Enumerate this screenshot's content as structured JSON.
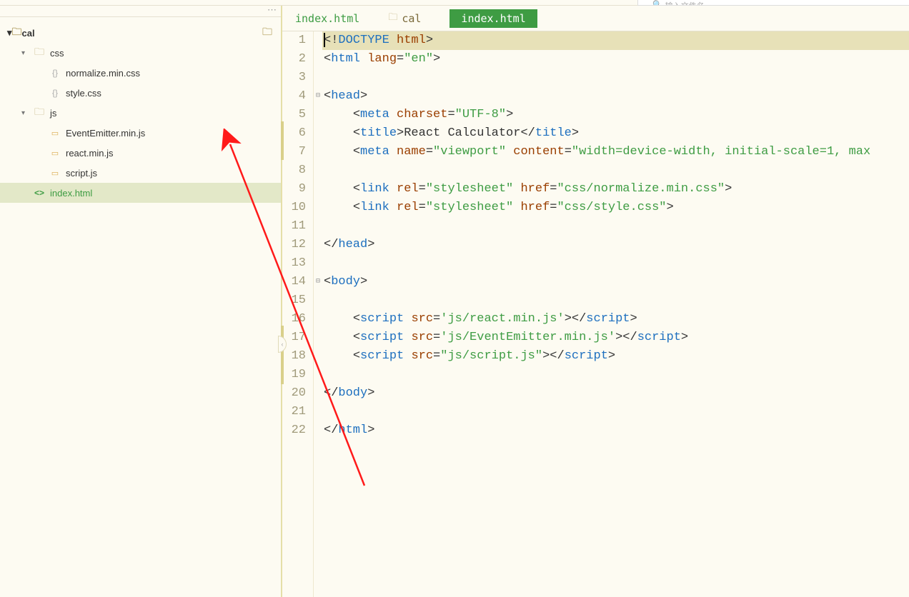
{
  "root_folder": "cal",
  "tree": {
    "css_folder": "css",
    "css_files": [
      "normalize.min.css",
      "style.css"
    ],
    "js_folder": "js",
    "js_files": [
      "EventEmitter.min.js",
      "react.min.js",
      "script.js"
    ],
    "html_file": "index.html"
  },
  "breadcrumb": {
    "file1": "index.html",
    "folder": "cal",
    "active": "index.html"
  },
  "code": {
    "lines": [
      {
        "n": 1,
        "fold": "",
        "hl": true,
        "html": "<span class='punct'>&lt;!</span><span class='tag'>DOCTYPE </span><span class='attr'>html</span><span class='punct'>&gt;</span>"
      },
      {
        "n": 2,
        "fold": "",
        "html": "<span class='punct'>&lt;</span><span class='tag'>html </span><span class='attr'>lang</span><span class='punct'>=</span><span class='string'>\"en\"</span><span class='punct'>&gt;</span>"
      },
      {
        "n": 3,
        "fold": "",
        "html": ""
      },
      {
        "n": 4,
        "fold": "⊟",
        "html": "<span class='punct'>&lt;</span><span class='tag'>head</span><span class='punct'>&gt;</span>"
      },
      {
        "n": 5,
        "fold": "",
        "html": "    <span class='punct'>&lt;</span><span class='tag'>meta </span><span class='attr'>charset</span><span class='punct'>=</span><span class='string'>\"UTF-8\"</span><span class='punct'>&gt;</span>"
      },
      {
        "n": 6,
        "fold": "",
        "html": "    <span class='punct'>&lt;</span><span class='tag'>title</span><span class='punct'>&gt;</span>React Calculator<span class='punct'>&lt;/</span><span class='tag'>title</span><span class='punct'>&gt;</span>"
      },
      {
        "n": 7,
        "fold": "",
        "html": "    <span class='punct'>&lt;</span><span class='tag'>meta </span><span class='attr'>name</span><span class='punct'>=</span><span class='string'>\"viewport\"</span> <span class='attr'>content</span><span class='punct'>=</span><span class='string'>\"width=device-width, initial-scale=1, max</span>"
      },
      {
        "n": 8,
        "fold": "",
        "html": ""
      },
      {
        "n": 9,
        "fold": "",
        "html": "    <span class='punct'>&lt;</span><span class='tag'>link </span><span class='attr'>rel</span><span class='punct'>=</span><span class='string'>\"stylesheet\"</span> <span class='attr'>href</span><span class='punct'>=</span><span class='string'>\"css/normalize.min.css\"</span><span class='punct'>&gt;</span>"
      },
      {
        "n": 10,
        "fold": "",
        "html": "    <span class='punct'>&lt;</span><span class='tag'>link </span><span class='attr'>rel</span><span class='punct'>=</span><span class='string'>\"stylesheet\"</span> <span class='attr'>href</span><span class='punct'>=</span><span class='string'>\"css/style.css\"</span><span class='punct'>&gt;</span>"
      },
      {
        "n": 11,
        "fold": "",
        "html": ""
      },
      {
        "n": 12,
        "fold": "",
        "html": "<span class='punct'>&lt;/</span><span class='tag'>head</span><span class='punct'>&gt;</span>"
      },
      {
        "n": 13,
        "fold": "",
        "html": ""
      },
      {
        "n": 14,
        "fold": "⊟",
        "html": "<span class='punct'>&lt;</span><span class='tag'>body</span><span class='punct'>&gt;</span>"
      },
      {
        "n": 15,
        "fold": "",
        "html": ""
      },
      {
        "n": 16,
        "fold": "",
        "html": "    <span class='punct'>&lt;</span><span class='tag'>script </span><span class='attr'>src</span><span class='punct'>=</span><span class='string'>'js/react.min.js'</span><span class='punct'>&gt;&lt;/</span><span class='tag'>script</span><span class='punct'>&gt;</span>"
      },
      {
        "n": 17,
        "fold": "",
        "html": "    <span class='punct'>&lt;</span><span class='tag'>script </span><span class='attr'>src</span><span class='punct'>=</span><span class='string'>'js/EventEmitter.min.js'</span><span class='punct'>&gt;&lt;/</span><span class='tag'>script</span><span class='punct'>&gt;</span>"
      },
      {
        "n": 18,
        "fold": "",
        "html": "    <span class='punct'>&lt;</span><span class='tag'>script </span><span class='attr'>src</span><span class='punct'>=</span><span class='string'>\"js/script.js\"</span><span class='punct'>&gt;&lt;/</span><span class='tag'>script</span><span class='punct'>&gt;</span>"
      },
      {
        "n": 19,
        "fold": "",
        "html": ""
      },
      {
        "n": 20,
        "fold": "",
        "html": "<span class='punct'>&lt;/</span><span class='tag'>body</span><span class='punct'>&gt;</span>"
      },
      {
        "n": 21,
        "fold": "",
        "html": ""
      },
      {
        "n": 22,
        "fold": "",
        "html": "<span class='punct'>&lt;/</span><span class='tag'>html</span><span class='punct'>&gt;</span>"
      }
    ]
  },
  "search_placeholder": "输入文件名"
}
